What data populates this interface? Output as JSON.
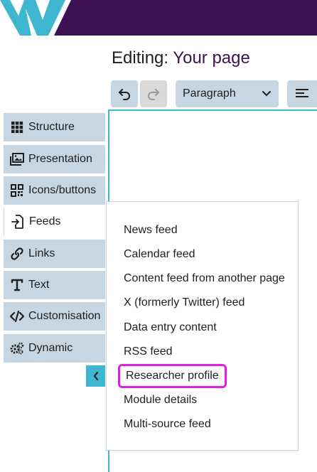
{
  "title": {
    "prefix": "Editing:",
    "page_name": "Your page"
  },
  "toolbar": {
    "undo_icon": "undo-icon",
    "redo_icon": "redo-icon",
    "format_value": "Paragraph",
    "align_icon": "align-left-icon"
  },
  "sidebar": {
    "items": [
      {
        "label": "Structure",
        "icon": "grid-icon"
      },
      {
        "label": "Presentation",
        "icon": "image-icon"
      },
      {
        "label": "Icons/buttons",
        "icon": "qr-icon"
      },
      {
        "label": "Feeds",
        "icon": "file-import-icon"
      },
      {
        "label": "Links",
        "icon": "link-icon"
      },
      {
        "label": "Text",
        "icon": "text-icon"
      },
      {
        "label": "Customisation",
        "icon": "code-icon"
      },
      {
        "label": "Dynamic",
        "icon": "gears-icon"
      }
    ],
    "collapse_icon": "chevron-left-icon"
  },
  "feeds_menu": {
    "items": [
      "News feed",
      "Calendar feed",
      "Content feed from another page",
      "X (formerly Twitter) feed",
      "Data entry content",
      "RSS feed",
      "Researcher profile",
      "Module details",
      "Multi-source feed"
    ],
    "highlighted": "Researcher profile"
  },
  "colors": {
    "brand_purple": "#3d1152",
    "brand_cyan": "#3fb6cf",
    "panel": "#c6d6e2",
    "highlight": "#e21ee0"
  }
}
